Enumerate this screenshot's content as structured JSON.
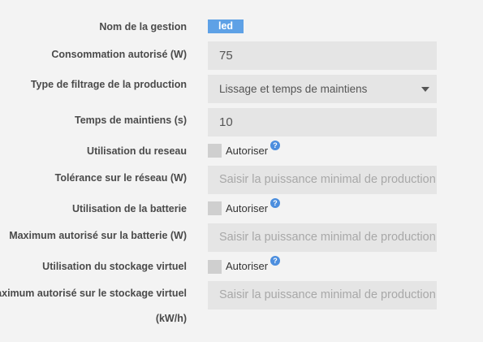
{
  "rows": {
    "nom": {
      "label": "Nom de la gestion",
      "value": "led"
    },
    "conso": {
      "label": "Consommation autorisé (W)",
      "value": "75"
    },
    "filtrage": {
      "label": "Type de filtrage de la production",
      "value": "Lissage et temps de maintiens"
    },
    "temps": {
      "label": "Temps de maintiens (s)",
      "value": "10"
    },
    "reseau": {
      "label": "Utilisation du reseau",
      "checkbox_label": "Autoriser",
      "checked": false
    },
    "tolerance": {
      "label": "Tolérance sur le réseau (W)",
      "placeholder": "Saisir la puissance minimal de production"
    },
    "batterie": {
      "label": "Utilisation de la batterie",
      "checkbox_label": "Autoriser",
      "checked": false
    },
    "max_batterie": {
      "label": "Maximum autorisé sur la batterie (W)",
      "placeholder": "Saisir la puissance minimal de production"
    },
    "stockage": {
      "label": "Utilisation du stockage virtuel",
      "checkbox_label": "Autoriser",
      "checked": false
    },
    "max_stockage": {
      "label_line1": "Maximum autorisé sur le stockage virtuel",
      "label_line2": "(kW/h)",
      "placeholder": "Saisir la puissance minimal de production"
    }
  },
  "help_glyph": "?",
  "colors": {
    "badge": "#5ea1e6",
    "help": "#4c8ede",
    "field_bg": "#e5e5e5",
    "page_bg": "#f3f3f3"
  }
}
